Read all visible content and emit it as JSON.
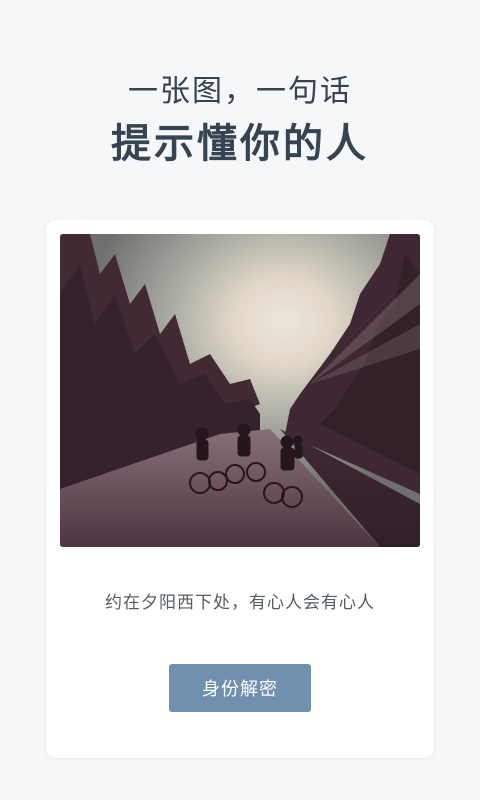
{
  "hero": {
    "line1": "一张图，一句话",
    "line2": "提示懂你的人"
  },
  "card": {
    "photo_description_icon": "sunset-cyclists-photo",
    "caption": "约在夕阳西下处，有心人会有心人",
    "button_label": "身份解密"
  },
  "colors": {
    "background": "#f5f7f9",
    "heading": "#364350",
    "button": "#7090b0",
    "caption": "#555c63"
  }
}
